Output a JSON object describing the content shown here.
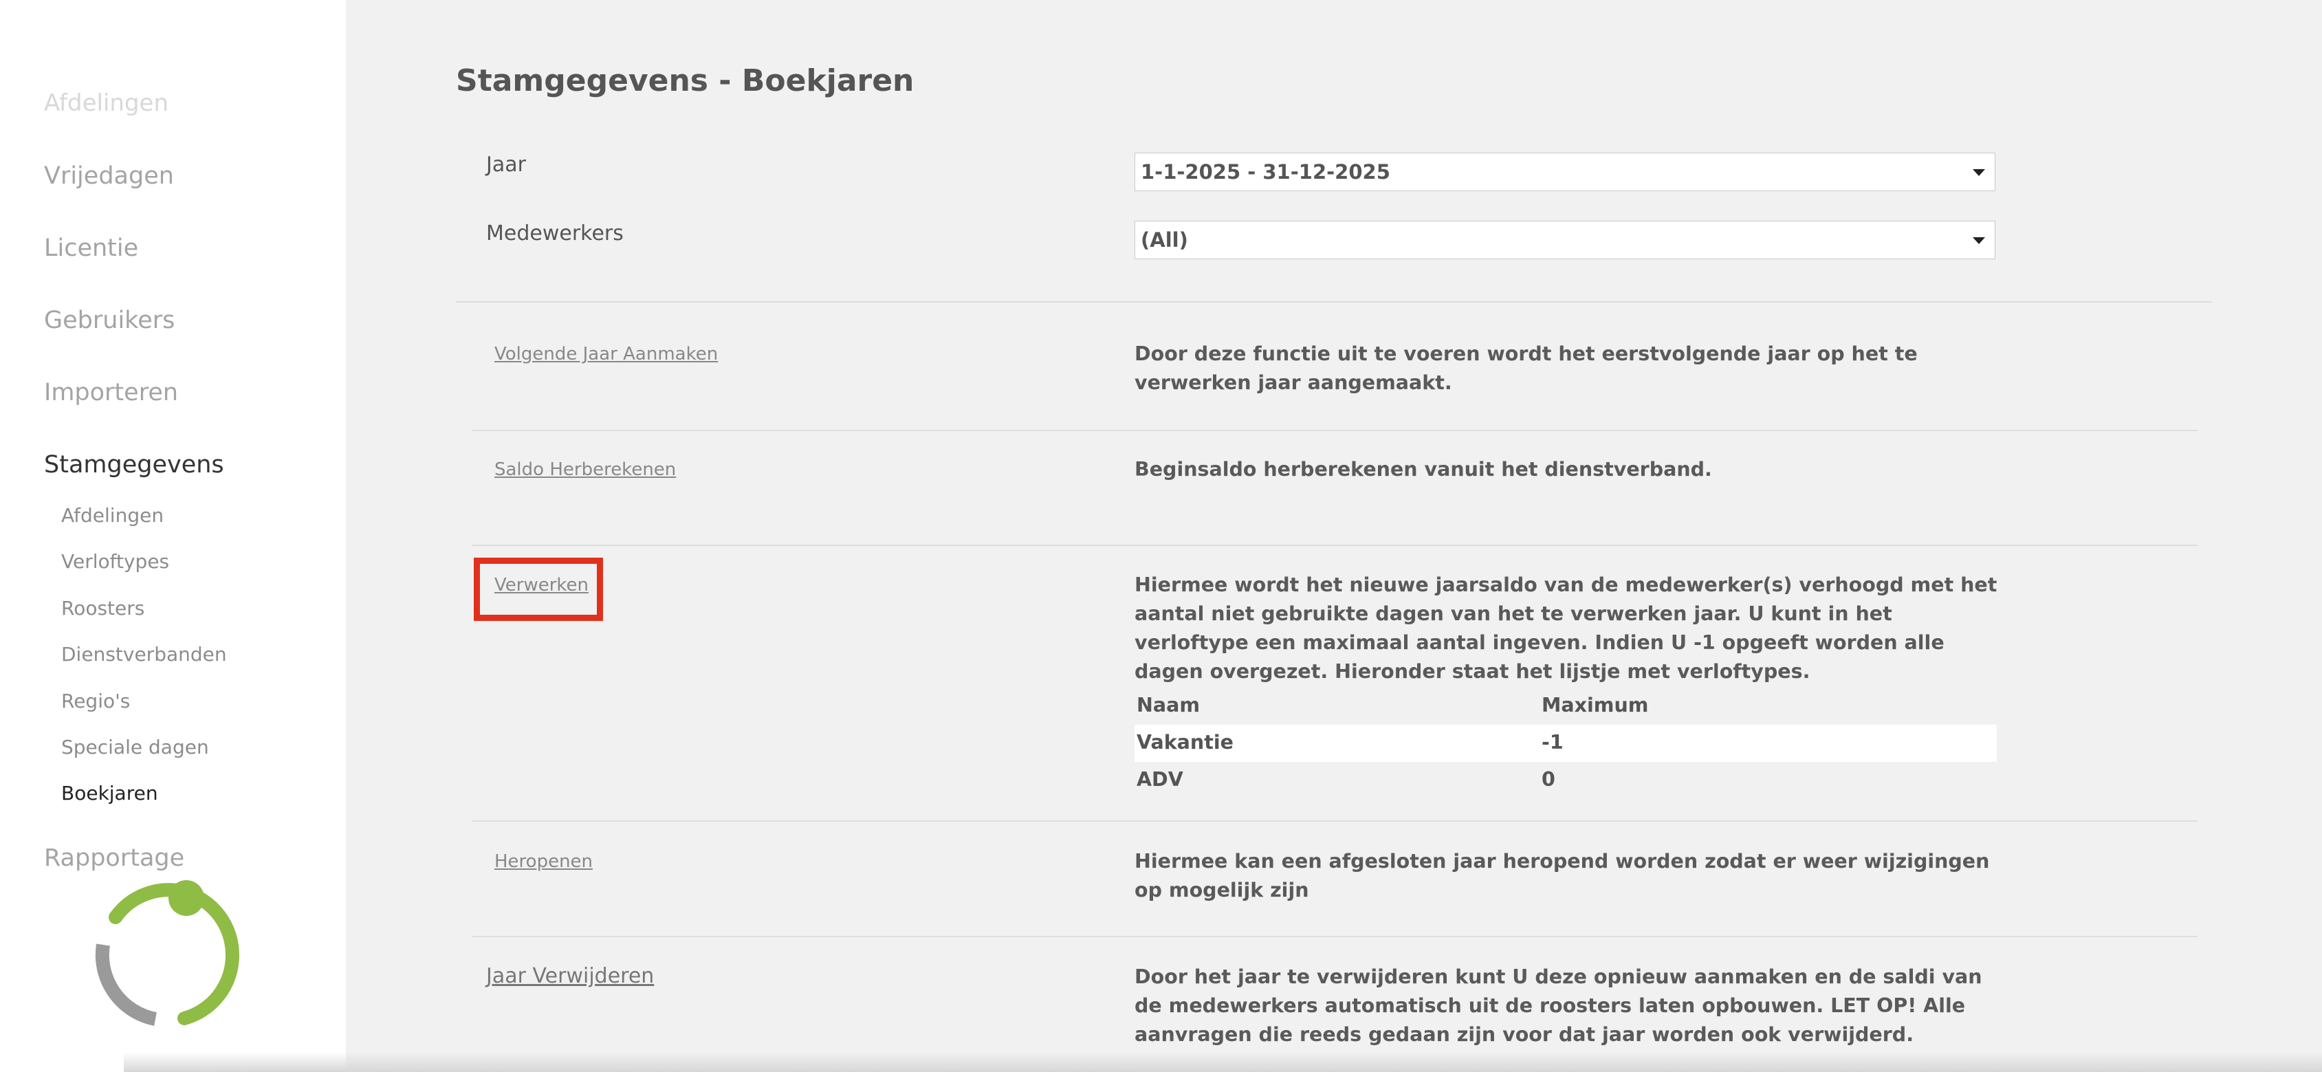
{
  "sidebar": {
    "top_partial": "Afdelingen",
    "items": [
      {
        "label": "Vrijedagen"
      },
      {
        "label": "Licentie"
      },
      {
        "label": "Gebruikers"
      },
      {
        "label": "Importeren"
      },
      {
        "label": "Stamgegevens"
      }
    ],
    "subitems": [
      {
        "label": "Afdelingen"
      },
      {
        "label": "Verloftypes"
      },
      {
        "label": "Roosters"
      },
      {
        "label": "Dienstverbanden"
      },
      {
        "label": "Regio's"
      },
      {
        "label": "Speciale dagen"
      },
      {
        "label": "Boekjaren"
      }
    ],
    "rapportage": "Rapportage"
  },
  "page": {
    "title": "Stamgegevens - Boekjaren"
  },
  "filters": {
    "jaar_label": "Jaar",
    "jaar_value": "1-1-2025 - 31-12-2025",
    "medewerkers_label": "Medewerkers",
    "medewerkers_value": "(All)"
  },
  "actions": [
    {
      "label": "Volgende Jaar Aanmaken",
      "description": "Door deze functie uit te voeren wordt het eerstvolgende jaar op het te verwerken jaar aangemaakt."
    },
    {
      "label": "Saldo Herberekenen",
      "description": "Beginsaldo herberekenen vanuit het dienstverband."
    },
    {
      "label": "Verwerken",
      "description": "Hiermee wordt het nieuwe jaarsaldo van de medewerker(s) verhoogd met het aantal niet gebruikte dagen van het te verwerken jaar. U kunt in het verloftype een maximaal aantal ingeven. Indien U -1 opgeeft worden alle dagen overgezet. Hieronder staat het lijstje met verloftypes."
    },
    {
      "label": "Heropenen",
      "description": "Hiermee kan een afgesloten jaar heropend worden zodat er weer wijzigingen op mogelijk zijn"
    },
    {
      "label": "Jaar Verwijderen",
      "description": "Door het jaar te verwijderen kunt U deze opnieuw aanmaken en de saldi van de medewerkers automatisch uit de roosters laten opbouwen. LET OP! Alle aanvragen die reeds gedaan zijn voor dat jaar worden ook verwijderd."
    }
  ],
  "verloftypes_table": {
    "headers": [
      "Naam",
      "Maximum"
    ],
    "rows": [
      [
        "Vakantie",
        "-1"
      ],
      [
        "ADV",
        "0"
      ]
    ]
  },
  "colors": {
    "highlight": "#e0311c",
    "spinner_green": "#8fbc45",
    "spinner_grey": "#9a9a9a"
  }
}
